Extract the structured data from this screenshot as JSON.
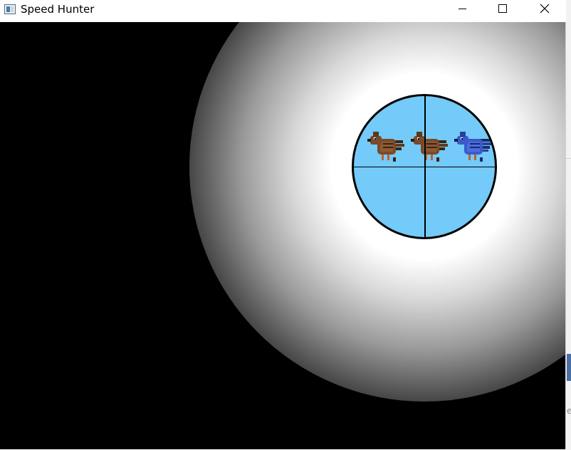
{
  "window": {
    "title": "Speed Hunter",
    "icon": "app-window-icon",
    "controls": [
      "minimize-icon",
      "maximize-icon",
      "close-icon"
    ]
  },
  "game": {
    "background_color": "#000000",
    "spotlight_color": "#ffffff",
    "scope": {
      "fill_color": "#74caf8",
      "border_color": "#000000",
      "crosshair_color": "#000000"
    },
    "birds": [
      {
        "kind": "brown-bird",
        "color": "#7a4a2a"
      },
      {
        "kind": "brown-bird",
        "color": "#7a4a2a"
      },
      {
        "kind": "blue-bird",
        "color": "#3a5bc8"
      }
    ]
  },
  "background": {
    "partial_text": "e"
  }
}
